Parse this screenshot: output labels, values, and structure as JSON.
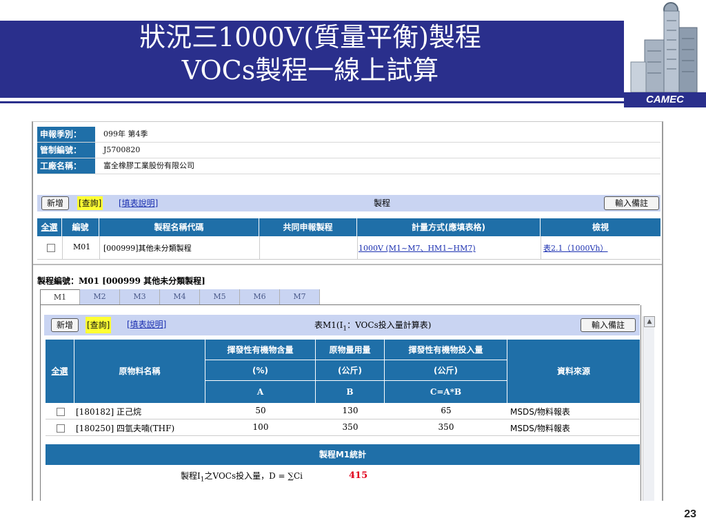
{
  "slide": {
    "title_line1": "狀況三1000V(質量平衡)製程",
    "title_line2": "VOCs製程一線上試算",
    "logo_text": "CAMEC",
    "page_number": "23"
  },
  "info": {
    "period_label": "申報季別：",
    "period_value": "099年 第4季",
    "control_no_label": "管制編號：",
    "control_no_value": "J5700820",
    "factory_label": "工廠名稱：",
    "factory_value": "富全橡膠工業股份有限公司"
  },
  "toolbar1": {
    "add": "新增",
    "query": "[查詢]",
    "help": "[填表說明]",
    "center": "製程",
    "note": "輸入備註"
  },
  "process_table": {
    "headers": [
      "全選",
      "編號",
      "製程名稱代碼",
      "共同申報製程",
      "計量方式(應填表格)",
      "檢視"
    ],
    "rows": [
      {
        "id": "M01",
        "name": "[000999]其他未分類製程",
        "shared": "",
        "method": "1000V (M1~M7、HM1~HM7)",
        "view": "表2.1（1000Vh）"
      }
    ]
  },
  "process_heading": "製程編號：M01 [000999  其他未分類製程]",
  "tabs": [
    "M1",
    "M2",
    "M3",
    "M4",
    "M5",
    "M6",
    "M7"
  ],
  "toolbar2": {
    "add": "新增",
    "query": "[查詢]",
    "help": "[填表說明]",
    "center_prefix": "表M1(I",
    "center_sub": "1",
    "center_suffix": "：VOCs投入量計算表)",
    "note": "輸入備註"
  },
  "material_table": {
    "select_all": "全選",
    "name_header": "原物料名稱",
    "col_a": {
      "title": "揮發性有機物含量",
      "unit": "(%)",
      "symbol": "A"
    },
    "col_b": {
      "title": "原物量用量",
      "unit": "(公斤)",
      "symbol": "B"
    },
    "col_c": {
      "title": "揮發性有機物投入量",
      "unit": "(公斤)",
      "symbol": "C=A*B"
    },
    "source_header": "資料來源",
    "rows": [
      {
        "name": "[180182] 正己烷",
        "a": "50",
        "b": "130",
        "c": "65",
        "source": "MSDS/物料報表"
      },
      {
        "name": "[180250] 四氫夫喃(THF)",
        "a": "100",
        "b": "350",
        "c": "350",
        "source": "MSDS/物料報表"
      }
    ],
    "total_title": "製程M1統計",
    "summary_prefix": "製程I",
    "summary_sub": "1",
    "summary_suffix": "之VOCs投入量，D = ∑Ci",
    "summary_value": "415"
  },
  "colors": {
    "banner": "#2a2f8c",
    "table_header": "#1f6fa8",
    "toolbar": "#c9d4f2",
    "query_highlight": "#ffff33",
    "link": "#1a2fb0",
    "total_value": "#e0001b"
  }
}
